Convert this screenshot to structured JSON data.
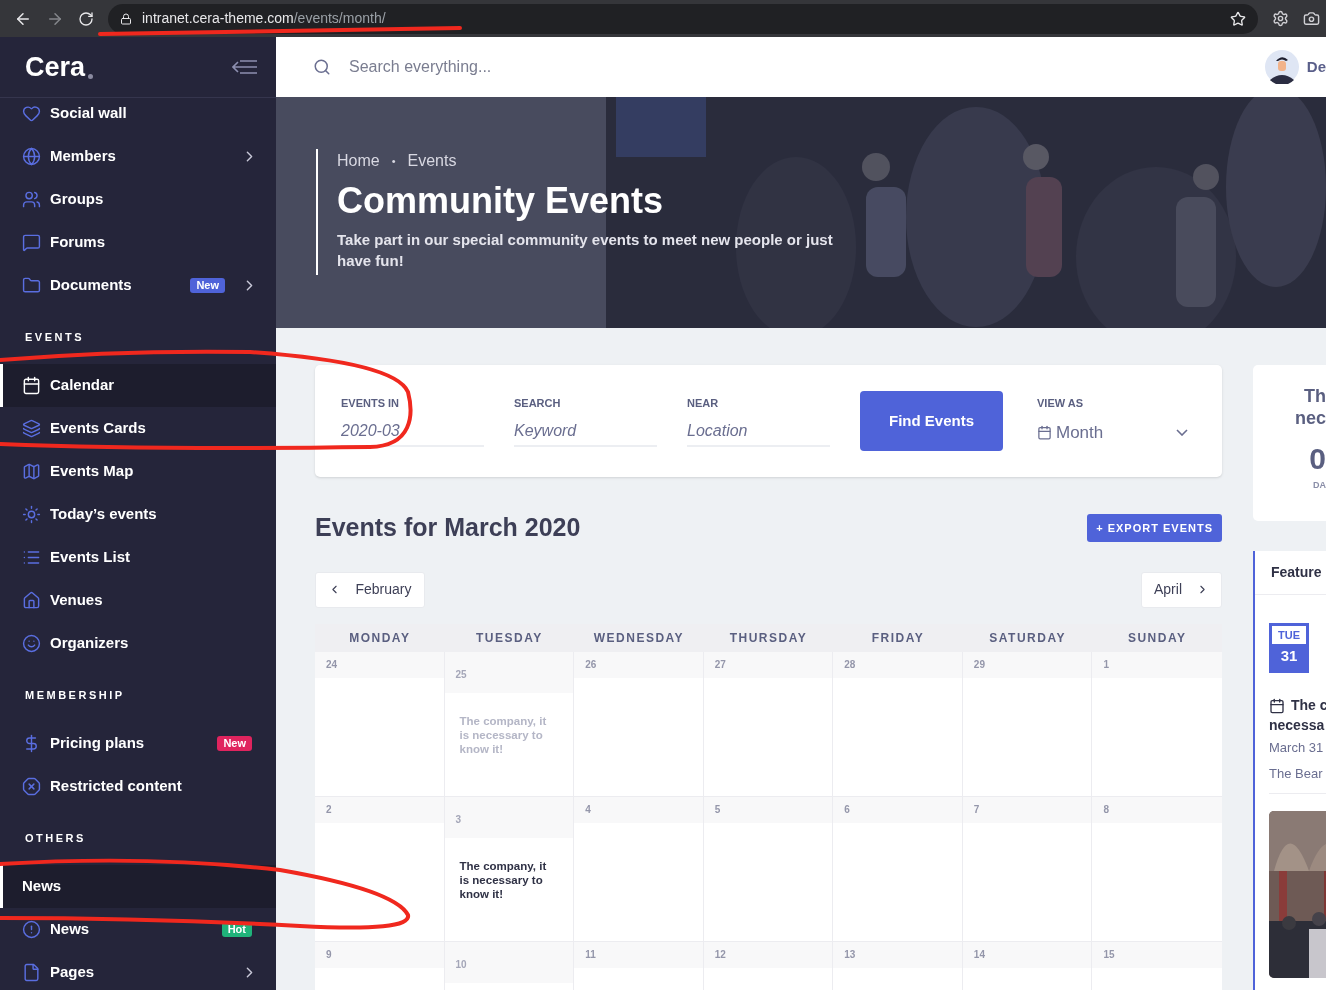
{
  "browser": {
    "url_host": "intranet.cera-theme.com",
    "url_path": "/events/month/"
  },
  "sidebar": {
    "logo": "Cera",
    "sections": [
      {
        "items": [
          {
            "label": "Social wall",
            "selected": false,
            "has_submenu": false
          },
          {
            "label": "Members",
            "selected": false,
            "has_submenu": true
          },
          {
            "label": "Groups",
            "selected": false,
            "has_submenu": false
          },
          {
            "label": "Forums",
            "selected": false,
            "has_submenu": false
          },
          {
            "label": "Documents",
            "selected": false,
            "has_submenu": true,
            "badge": {
              "text": "New",
              "color": "#4f63d9"
            }
          }
        ]
      },
      {
        "heading": "EVENTS",
        "items": [
          {
            "label": "Calendar",
            "selected": true,
            "has_submenu": false
          },
          {
            "label": "Events Cards",
            "selected": false,
            "has_submenu": false
          },
          {
            "label": "Events Map",
            "selected": false,
            "has_submenu": false
          },
          {
            "label": "Today’s events",
            "selected": false,
            "has_submenu": false
          },
          {
            "label": "Events List",
            "selected": false,
            "has_submenu": false
          },
          {
            "label": "Venues",
            "selected": false,
            "has_submenu": false
          },
          {
            "label": "Organizers",
            "selected": false,
            "has_submenu": false
          }
        ]
      },
      {
        "heading": "MEMBERSHIP",
        "items": [
          {
            "label": "Pricing plans",
            "selected": false,
            "has_submenu": false,
            "badge": {
              "text": "New",
              "color": "#e0245e"
            }
          },
          {
            "label": "Restricted content",
            "selected": false,
            "has_submenu": false
          }
        ]
      },
      {
        "heading": "OTHERS",
        "items": [
          {
            "label": "News",
            "selected": true,
            "has_submenu": false
          },
          {
            "label": "News",
            "selected": false,
            "has_submenu": false,
            "badge": {
              "text": "Hot",
              "color": "#1fb37a"
            }
          },
          {
            "label": "Pages",
            "selected": false,
            "has_submenu": true
          }
        ]
      }
    ]
  },
  "header": {
    "search": {
      "placeholder": "Search everything..."
    },
    "user_name": "De"
  },
  "hero": {
    "breadcrumb": [
      "Home",
      "Events"
    ],
    "separator": "•",
    "title": "Community Events",
    "subtitle": "Take part in our special community events to meet new people or just have fun!"
  },
  "filters": {
    "fields": [
      {
        "label": "EVENTS IN",
        "value": "2020-03"
      },
      {
        "label": "SEARCH",
        "placeholder": "Keyword"
      },
      {
        "label": "NEAR",
        "placeholder": "Location"
      }
    ],
    "submit": "Find Events",
    "view": {
      "label": "VIEW AS",
      "value": "Month"
    }
  },
  "calendar": {
    "title": "Events for March 2020",
    "export": "+ EXPORT EVENTS",
    "prev": "February",
    "next": "April",
    "weekdays": [
      "MONDAY",
      "TUESDAY",
      "WEDNESDAY",
      "THURSDAY",
      "FRIDAY",
      "SATURDAY",
      "SUNDAY"
    ],
    "weeks": [
      [
        {
          "day": "24"
        },
        {
          "day": "25",
          "event": {
            "text": "The company, it is necessary to know it!",
            "past": true
          }
        },
        {
          "day": "26"
        },
        {
          "day": "27"
        },
        {
          "day": "28"
        },
        {
          "day": "29"
        },
        {
          "day": "1"
        }
      ],
      [
        {
          "day": "2"
        },
        {
          "day": "3",
          "event": {
            "text": "The company, it is necessary to know it!",
            "past": false
          }
        },
        {
          "day": "4"
        },
        {
          "day": "5"
        },
        {
          "day": "6"
        },
        {
          "day": "7"
        },
        {
          "day": "8"
        }
      ],
      [
        {
          "day": "9"
        },
        {
          "day": "10"
        },
        {
          "day": "11"
        },
        {
          "day": "12"
        },
        {
          "day": "13"
        },
        {
          "day": "14"
        },
        {
          "day": "15"
        }
      ]
    ]
  },
  "countdown": {
    "title_lines": [
      "Th",
      "nec"
    ],
    "value": "0",
    "unit": "DA"
  },
  "featured": {
    "heading": "Feature",
    "weekday": "TUE",
    "day": "31",
    "title_lines": [
      "The c",
      "necessa"
    ],
    "date": "March 31",
    "venue": "The Bear",
    "image": {
      "kind": "picture"
    }
  }
}
